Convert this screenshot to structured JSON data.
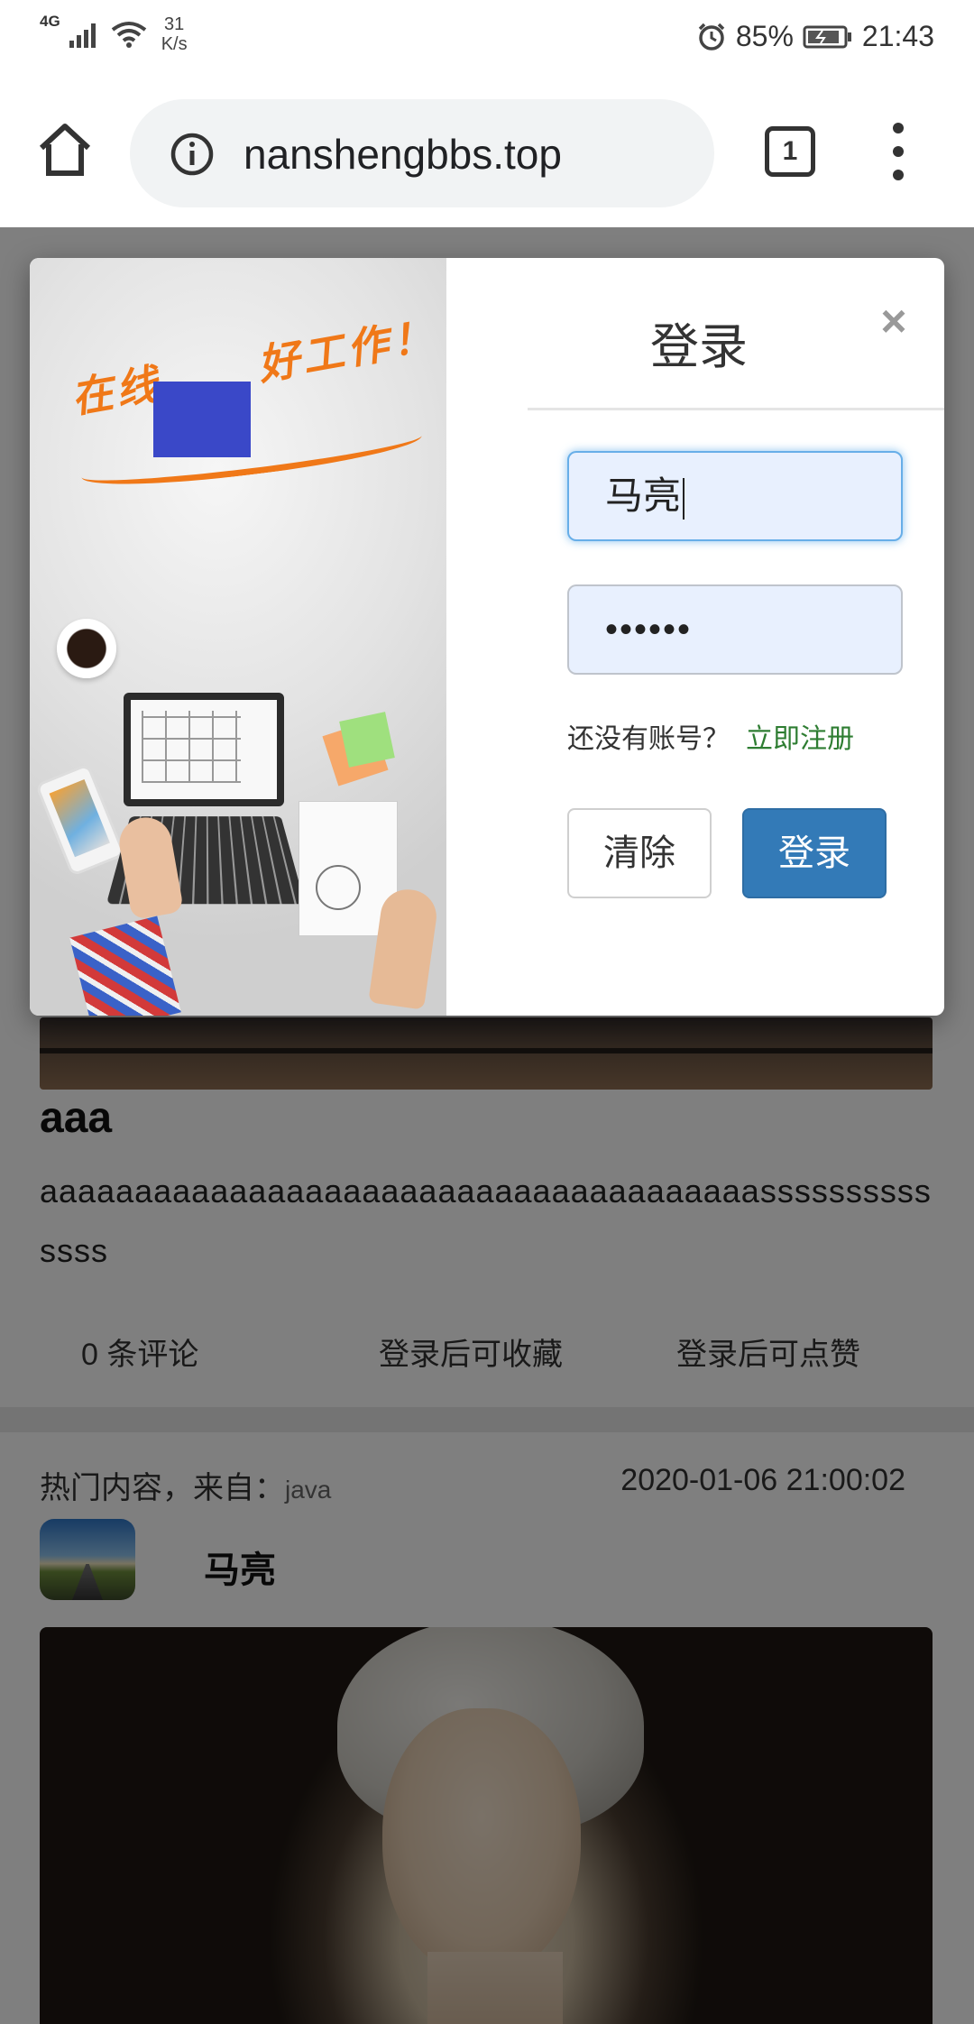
{
  "status_bar": {
    "network": "4G",
    "speed_value": "31",
    "speed_unit": "K/s",
    "battery": "85%",
    "time": "21:43"
  },
  "browser": {
    "url": "nanshengbbs.top",
    "tab_count": "1"
  },
  "login_modal": {
    "title": "登录",
    "close": "×",
    "art_slogan_left": "在线",
    "art_slogan_right": "好工作！",
    "username_value": "马亮",
    "password_value": "••••••",
    "no_account_text": "还没有账号？",
    "register_link": "立即注册",
    "clear_button": "清除",
    "login_button": "登录"
  },
  "feed": {
    "post1": {
      "title": "aaa",
      "body": "aaaaaaaaaaaaaaaaaaaaaaaaaaaaaaaaaaaaaassssssssssssss",
      "comments": "0 条评论",
      "collect": "登录后可收藏",
      "like": "登录后可点赞"
    },
    "post2": {
      "source_label": "热门内容，来自：",
      "category": "java",
      "date": "2020-01-06 21:00:02",
      "author": "马亮"
    }
  }
}
